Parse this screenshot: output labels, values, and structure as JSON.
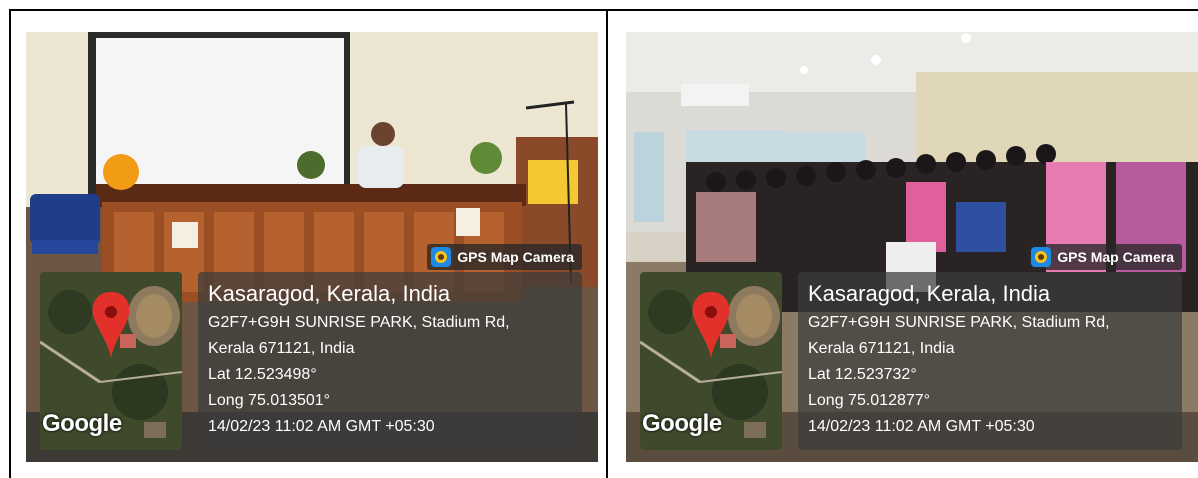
{
  "photos": [
    {
      "badge": "GPS Map Camera",
      "place": "Kasaragod, Kerala, India",
      "address_line1": "G2F7+G9H SUNRISE PARK, Stadium Rd,",
      "address_line2": "Kerala 671121, India",
      "lat": "Lat 12.523498°",
      "long": "Long 75.013501°",
      "timestamp": "14/02/23 11:02 AM GMT +05:30",
      "map_brand": "Google"
    },
    {
      "badge": "GPS Map Camera",
      "place": "Kasaragod, Kerala, India",
      "address_line1": "G2F7+G9H SUNRISE PARK, Stadium Rd,",
      "address_line2": "Kerala 671121, India",
      "lat": "Lat 12.523732°",
      "long": "Long 75.012877°",
      "timestamp": "14/02/23 11:02 AM GMT +05:30",
      "map_brand": "Google"
    }
  ],
  "icons": [
    "gps-camera-icon",
    "map-pin-icon"
  ]
}
